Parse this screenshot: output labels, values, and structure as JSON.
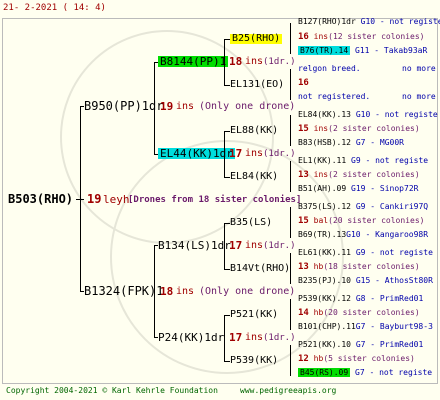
{
  "header": {
    "date": "21-   2-2021  ( 14:   4)"
  },
  "footer": {
    "copyright": "Copyright 2004-2021 © Karl Kehrle Foundation",
    "url": "www.pedigreeapis.org"
  },
  "nodes": {
    "root": {
      "name": "B503(RHO)",
      "num": "19",
      "suffix": "leyh",
      "note": "[Drones from 18 sister colonies]"
    },
    "g1a": {
      "name": "B950(PP)1dr",
      "num": "19",
      "unit": "ins",
      "note": "(Only one drone)"
    },
    "g1b": {
      "name": "B1324(FPK)1",
      "num": "18",
      "unit": "ins",
      "note": "(Only one drone)"
    },
    "g2a": {
      "name": "B8144(PP)1",
      "num": "18",
      "unit": "ins",
      "note": "(1dr.)"
    },
    "g2b": {
      "name": "EL44(KK)1dr",
      "num": "17",
      "unit": "ins",
      "note": "(1dr.)"
    },
    "g2c": {
      "name": "B134(LS)1dr",
      "num": "17",
      "unit": "ins",
      "note": "(1dr.)"
    },
    "g2d": {
      "name": "P24(KK)1dr",
      "num": "17",
      "unit": "ins",
      "note": "(1dr.)"
    },
    "g3a": {
      "name": "B25(RHO)"
    },
    "g3b": {
      "name": "EL131(EO)"
    },
    "g3c": {
      "name": "EL88(KK)"
    },
    "g3d": {
      "name": "EL84(KK)"
    },
    "g3e": {
      "name": "B35(LS)"
    },
    "g3f": {
      "name": "B14Vt(RHO)"
    },
    "g3g": {
      "name": "P521(KK)"
    },
    "g3h": {
      "name": "P539(KK)"
    }
  },
  "right": [
    {
      "a": "B127(RHO)1dr",
      "b": "G10",
      "c": "- not registe"
    },
    {
      "num": "16",
      "unit": "ins",
      "note": "(12 sister colonies)"
    },
    {
      "a": "B76(TR).14",
      "b": "G11",
      "c": "- Takab93aR"
    },
    {
      "a": "relgon breed.",
      "c": "no more"
    },
    {
      "num": "16"
    },
    {
      "a": "not registered.",
      "c": "no more"
    },
    {
      "a": "EL84(KK).13",
      "b": "G10",
      "c": "- not registe"
    },
    {
      "num": "15",
      "unit": "ins",
      "note": "(2 sister colonies)"
    },
    {
      "a": "B83(HSB).12",
      "b": "G7",
      "c": "- MG00R"
    },
    {
      "a": "EL1(KK).11",
      "b": "G9",
      "c": "- not registe"
    },
    {
      "num": "13",
      "unit": "ins",
      "note": "(2 sister colonies)"
    },
    {
      "a": "B51(AH).09",
      "b": "G19",
      "c": "- Sinop72R"
    },
    {
      "a": "B375(LS).12",
      "b": "G9",
      "c": "- Cankiri97Q"
    },
    {
      "num": "15",
      "unit": "bal",
      "note": "(20 sister colonies)"
    },
    {
      "a": "B69(TR).13",
      "b": "G10",
      "c": "- Kangaroo98R"
    },
    {
      "a": "EL61(KK).11",
      "b": "G9",
      "c": "- not registe"
    },
    {
      "num": "13",
      "unit": "hb",
      "note": "(18 sister colonies)"
    },
    {
      "a": "B235(PJ).10",
      "b": "G15",
      "c": "- AthosSt80R"
    },
    {
      "a": "P539(KK).12",
      "b": "G8",
      "c": "- PrimRed01"
    },
    {
      "num": "14",
      "unit": "hb",
      "note": "(20 sister colonies)"
    },
    {
      "a": "B101(CHP).11",
      "b": "G7",
      "c": "- Bayburt98-3"
    },
    {
      "a": "P521(KK).10",
      "b": "G7",
      "c": "- PrimRed01"
    },
    {
      "num": "12",
      "unit": "hb",
      "note": "(5 sister colonies)"
    },
    {
      "a": "B45(RS).09",
      "b": "G7",
      "c": "- not registe"
    }
  ]
}
